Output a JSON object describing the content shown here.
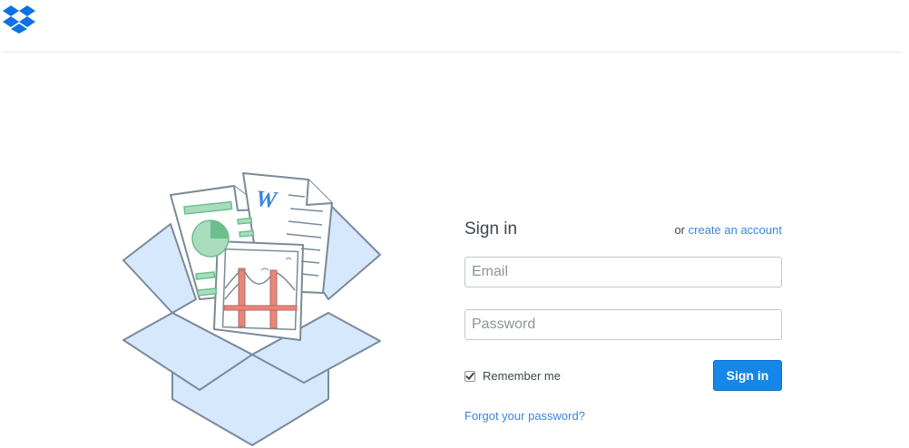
{
  "colors": {
    "brand_blue": "#0d71e3",
    "link_blue": "#3986e0",
    "button_blue": "#1587e8",
    "box_fill": "#d6e8fb",
    "box_stroke": "#7a8a99"
  },
  "header": {
    "logo_icon": "dropbox-logo-icon"
  },
  "illustration": {
    "name": "open-box-with-files-illustration",
    "word_doc_letter": "W"
  },
  "signin": {
    "title": "Sign in",
    "or_text": "or",
    "create_account_link": "create an account",
    "email_placeholder": "Email",
    "email_value": "",
    "password_placeholder": "Password",
    "password_value": "",
    "remember_label": "Remember me",
    "remember_checked": true,
    "submit_label": "Sign in",
    "forgot_link": "Forgot your password?"
  }
}
